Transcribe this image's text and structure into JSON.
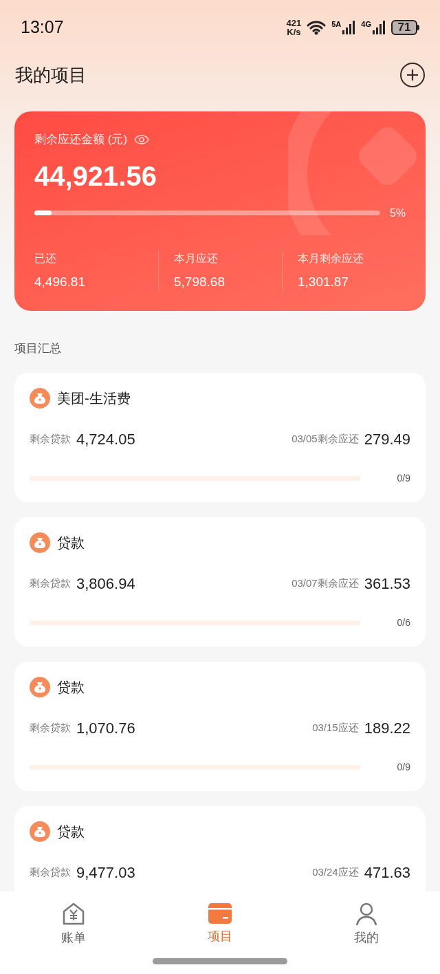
{
  "status_bar": {
    "time": "13:07",
    "speed": "421",
    "speed_unit": "K/s",
    "sim1": "5A",
    "sim2": "4G",
    "battery": "71"
  },
  "title": "我的项目",
  "summary": {
    "label": "剩余应还金额 (元)",
    "amount": "44,921.56",
    "level": 0.05,
    "percent": "5%",
    "stats": [
      {
        "label": "已还",
        "value": "4,496.81"
      },
      {
        "label": "本月应还",
        "value": "5,798.68"
      },
      {
        "label": "本月剩余应还",
        "value": "1,301.87"
      }
    ]
  },
  "section_title": "项目汇总",
  "projects": [
    {
      "name": "美团-生活费",
      "loan_label": "剩余贷款",
      "loan": "4,724.05",
      "due_label": "03/05剩余应还",
      "due": "279.49",
      "progress": {
        "level": 0,
        "label": "0/9"
      }
    },
    {
      "name": "贷款",
      "loan_label": "剩余贷款",
      "loan": "3,806.94",
      "due_label": "03/07剩余应还",
      "due": "361.53",
      "progress": {
        "level": 0,
        "label": "0/6"
      }
    },
    {
      "name": "贷款",
      "loan_label": "剩余贷款",
      "loan": "1,070.76",
      "due_label": "03/15应还",
      "due": "189.22",
      "progress": {
        "level": 0,
        "label": "0/9"
      }
    },
    {
      "name": "贷款",
      "loan_label": "剩余贷款",
      "loan": "9,477.03",
      "due_label": "03/24应还",
      "due": "471.63"
    }
  ],
  "tabs": [
    {
      "kind": "bill",
      "label": "账单",
      "selected": false
    },
    {
      "kind": "project",
      "label": "项目",
      "selected": true
    },
    {
      "kind": "profile",
      "label": "我的",
      "selected": false
    }
  ]
}
